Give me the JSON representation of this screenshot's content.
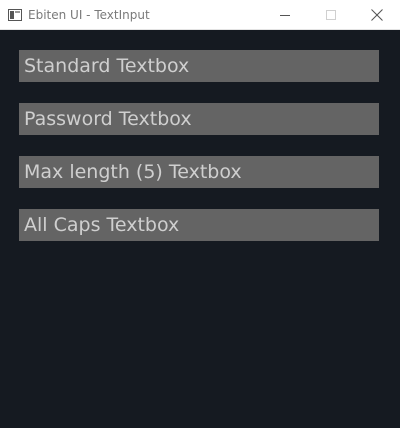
{
  "window": {
    "title": "Ebiten UI - TextInput",
    "background_color": "#151a21",
    "app_icon": "ebiten-app-icon",
    "controls": {
      "minimize_icon": "minimize-icon",
      "maximize_icon": "maximize-icon",
      "close_icon": "close-icon"
    }
  },
  "textboxes": [
    {
      "placeholder": "Standard Textbox",
      "value": ""
    },
    {
      "placeholder": "Password Textbox",
      "value": ""
    },
    {
      "placeholder": "Max length (5) Textbox",
      "value": ""
    },
    {
      "placeholder": "All Caps Textbox",
      "value": ""
    }
  ],
  "colors": {
    "textbox_background": "#646464",
    "textbox_text": "#cfcfcf"
  }
}
